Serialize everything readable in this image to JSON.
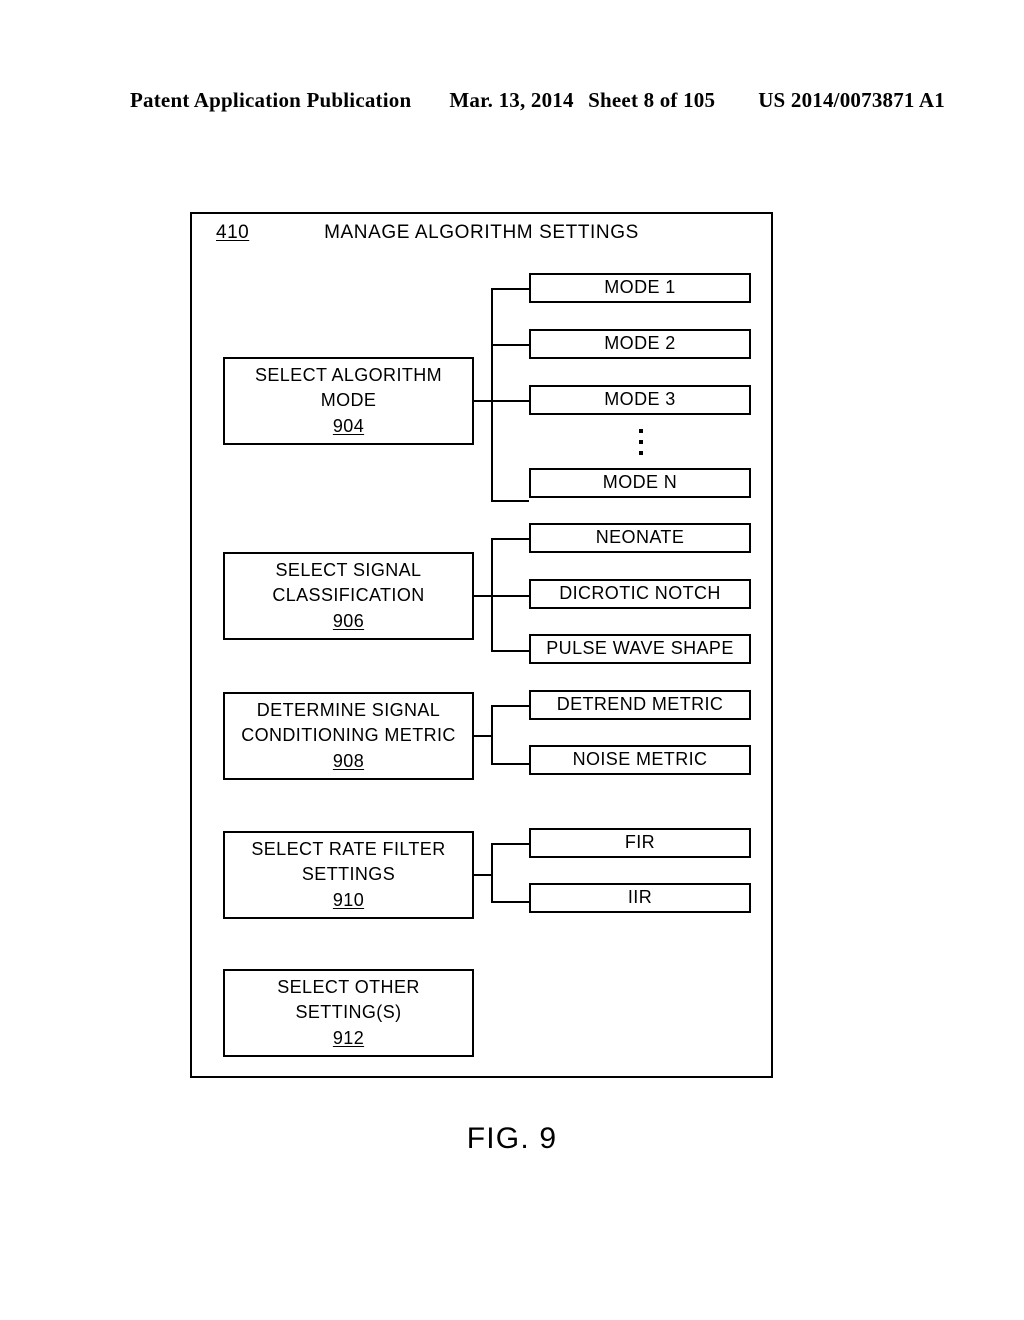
{
  "header": {
    "publication": "Patent Application Publication",
    "date": "Mar. 13, 2014",
    "sheet": "Sheet 8 of 105",
    "patent_number": "US 2014/0073871 A1"
  },
  "diagram": {
    "frame_ref": "410",
    "title": "MANAGE ALGORITHM SETTINGS",
    "groups": [
      {
        "name": "select-algorithm-mode",
        "label_line1": "SELECT ALGORITHM",
        "label_line2": "MODE",
        "ref": "904",
        "options": [
          "MODE 1",
          "MODE 2",
          "MODE 3",
          "MODE N"
        ],
        "has_ellipsis": true
      },
      {
        "name": "select-signal-classification",
        "label_line1": "SELECT SIGNAL",
        "label_line2": "CLASSIFICATION",
        "ref": "906",
        "options": [
          "NEONATE",
          "DICROTIC NOTCH",
          "PULSE WAVE SHAPE"
        ],
        "has_ellipsis": false
      },
      {
        "name": "determine-signal-conditioning-metric",
        "label_line1": "DETERMINE SIGNAL",
        "label_line2": "CONDITIONING METRIC",
        "ref": "908",
        "options": [
          "DETREND METRIC",
          "NOISE METRIC"
        ],
        "has_ellipsis": false
      },
      {
        "name": "select-rate-filter-settings",
        "label_line1": "SELECT RATE FILTER",
        "label_line2": "SETTINGS",
        "ref": "910",
        "options": [
          "FIR",
          "IIR"
        ],
        "has_ellipsis": false
      },
      {
        "name": "select-other-settings",
        "label_line1": "SELECT OTHER",
        "label_line2": "SETTING(S)",
        "ref": "912",
        "options": [],
        "has_ellipsis": false
      }
    ]
  },
  "figure_caption": "FIG. 9"
}
